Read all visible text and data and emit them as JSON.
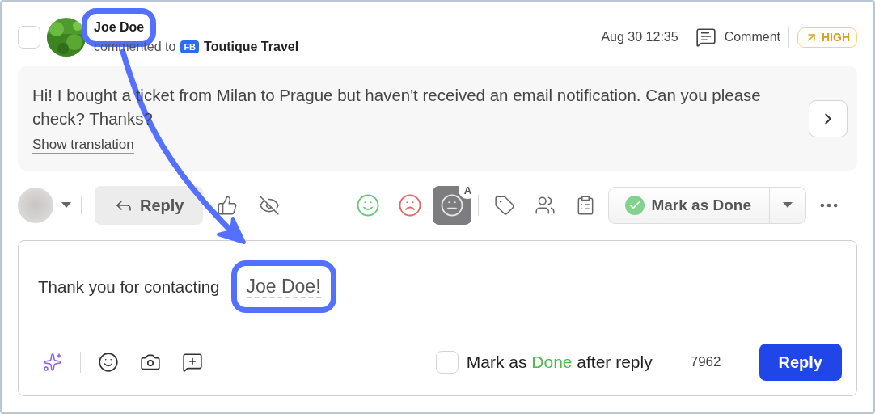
{
  "message": {
    "checked": false,
    "author": "Joe Doe",
    "action": "commented to",
    "channel_badge": "FB",
    "page": "Toutique Travel",
    "timestamp": "Aug 30 12:35",
    "type": "Comment",
    "priority": "HIGH",
    "text": "Hi! I bought a ticket from Milan to Prague but haven't received an email notification. Can you please check? Thanks?",
    "translation_link": "Show translation"
  },
  "toolbar": {
    "reply_label": "Reply",
    "sentiments": [
      {
        "kind": "positive",
        "selected": false
      },
      {
        "kind": "negative",
        "selected": false
      },
      {
        "kind": "neutral",
        "selected": true,
        "badge": "A"
      }
    ],
    "mark_done": "Mark as Done"
  },
  "composer": {
    "text": "Thank you for contacting",
    "variable": "Joe Doe!",
    "mark_done_after_reply": {
      "checked": false,
      "before": "Mark as",
      "highlight": "Done",
      "after": "after reply"
    },
    "counter": "7962",
    "send": "Reply"
  }
}
